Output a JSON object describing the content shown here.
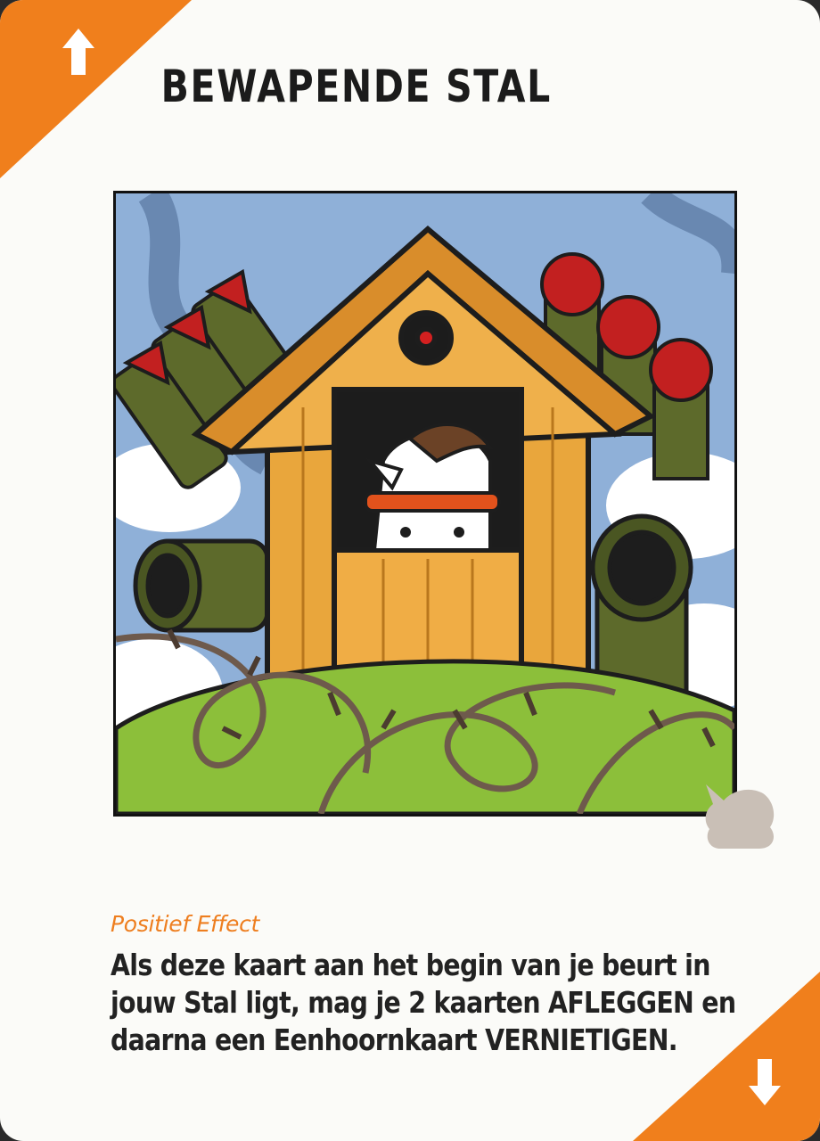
{
  "card": {
    "title": "BEWAPENDE STAL",
    "effect_label": "Positief Effect",
    "effect_lines": [
      "Als deze kaart aan het begin van je beurt in",
      "jouw Stal ligt, mag je 2 kaarten AFLEGGEN en",
      "daarna een Eenhoornkaart VERNIETIGEN."
    ],
    "illustration": "armored-stable-unicorn-illustration",
    "icons": {
      "top_left": "arrow-up-icon",
      "bottom_right": "arrow-down-icon",
      "watermark": "unicorn-head-icon"
    },
    "colors": {
      "accent": "#f07f1c",
      "effect_label": "#ee7e1f",
      "card_background": "#fbfbf8",
      "text": "#222222"
    }
  }
}
